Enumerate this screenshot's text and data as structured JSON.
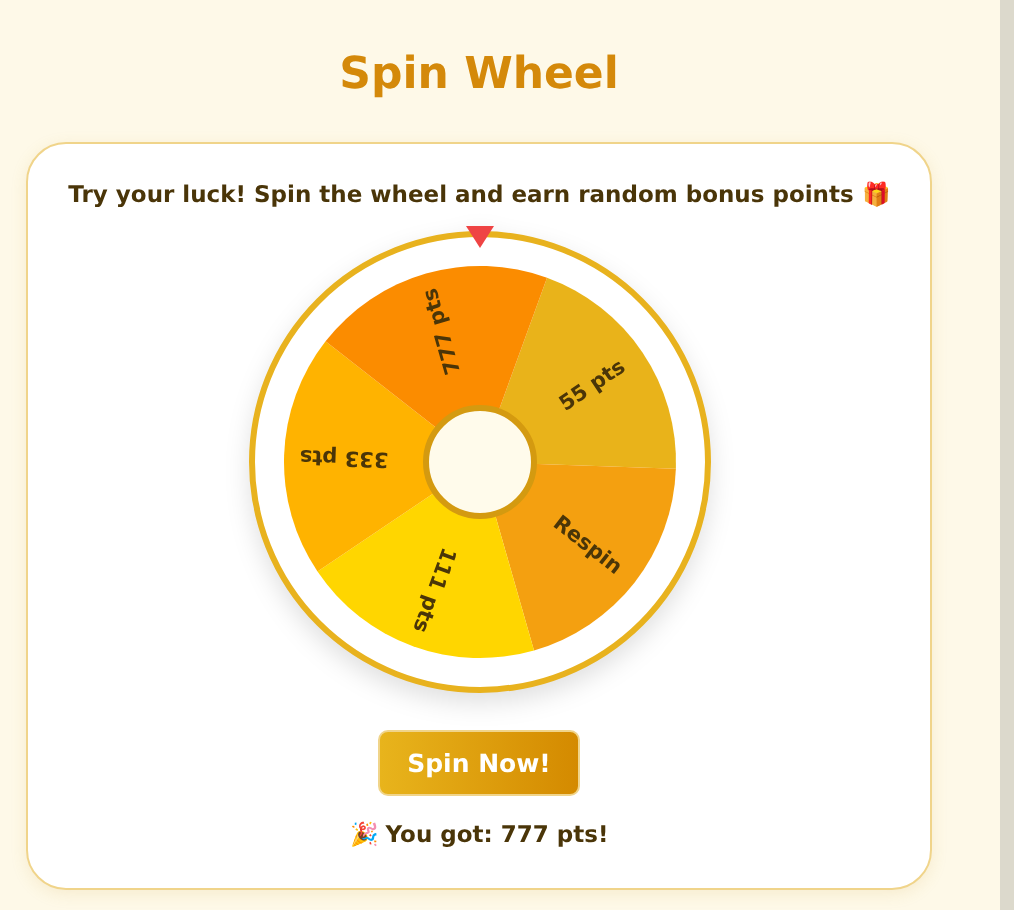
{
  "title": "Spin Wheel",
  "intro": "Try your luck! Spin the wheel and earn random bonus points 🎁",
  "wheel": {
    "segments": [
      {
        "label": "55 pts",
        "color": "#e9b31a"
      },
      {
        "label": "Respin",
        "color": "#f4a010"
      },
      {
        "label": "111 pts",
        "color": "#ffd600"
      },
      {
        "label": "333 pts",
        "color": "#ffb300"
      },
      {
        "label": "777 pts",
        "color": "#fb8c00"
      }
    ]
  },
  "button": "Spin Now!",
  "result": "🎉 You got: 777 pts!"
}
